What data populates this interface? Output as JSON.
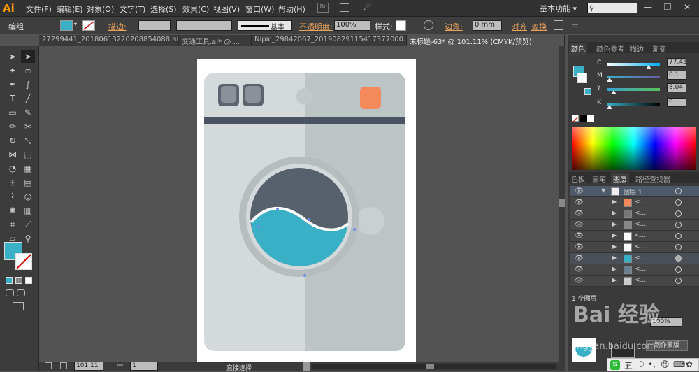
{
  "menubar": {
    "logo": "Ai",
    "items": [
      "文件(F)",
      "编辑(E)",
      "对象(O)",
      "文字(T)",
      "选择(S)",
      "效果(C)",
      "视图(V)",
      "窗口(W)",
      "帮助(H)"
    ],
    "workspace": "基本功能",
    "workspace_caret": "▾"
  },
  "control": {
    "selection": "编组",
    "stroke_label": "描边:",
    "brush": "基本",
    "opacity_label": "不透明度:",
    "opacity_value": "100%",
    "style_label": "样式:",
    "corner_label": "边角:",
    "corner_value": "0 mm",
    "align_label": "对齐",
    "transform_label": "变换"
  },
  "tabs": [
    {
      "label": "27299441_20180613220208854088.ai*"
    },
    {
      "label": "交通工具.ai* @ ..."
    },
    {
      "label": "Nipic_29842067_20190829115417377000.ai*"
    },
    {
      "label": "未标题-63* @ 101.11% (CMYK/预览)"
    }
  ],
  "status": {
    "zoom": "101.11",
    "page": "1",
    "tool": "直接选择"
  },
  "color_panel": {
    "tabs": [
      "颜色",
      "颜色参考",
      "描边",
      "渐变"
    ],
    "channels": [
      {
        "label": "C",
        "value": "77.45",
        "level": 0.7745
      },
      {
        "label": "M",
        "value": "0.1",
        "level": 0.001
      },
      {
        "label": "Y",
        "value": "8.04",
        "level": 0.0804
      },
      {
        "label": "K",
        "value": "0",
        "level": 0
      }
    ]
  },
  "layers_panel": {
    "tabs": [
      "色板",
      "画笔",
      "图层",
      "路径查找器"
    ],
    "layer_name": "图层 1",
    "sublayer_label": "<...",
    "count_label": "1 个图层"
  },
  "lower_panel": {
    "transparency_value": "100%",
    "button": "制作蒙版"
  },
  "colors": {
    "fill": "#39b0c6",
    "accent": "#e8a25a"
  },
  "overlay": {
    "watermark": "Bai 经验",
    "watermark_sub": "jingyan.baidu.com"
  }
}
